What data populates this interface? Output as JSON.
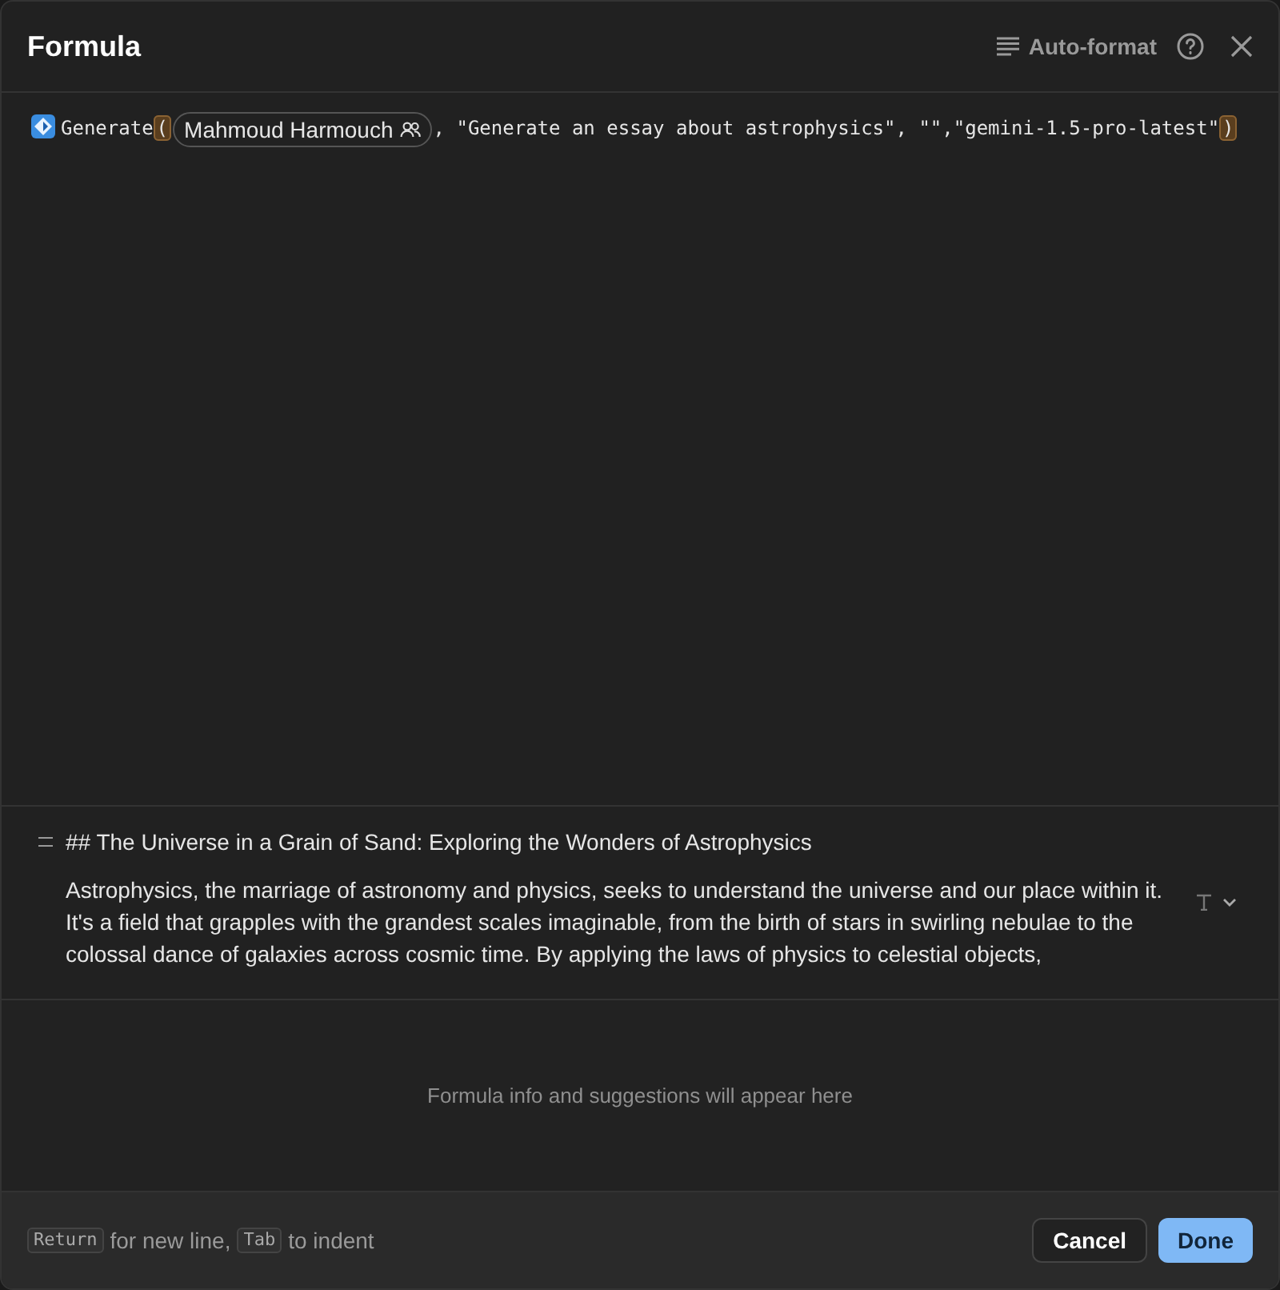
{
  "dialog": {
    "title": "Formula",
    "auto_format": "Auto-format"
  },
  "formula": [
    {
      "kind": "function",
      "text": "Generate"
    },
    {
      "kind": "paren",
      "text": "("
    },
    {
      "kind": "chip",
      "text": "Mahmoud Harmouch"
    },
    {
      "kind": "text",
      "text": ", \"Generate an essay about astrophysics\", \"\",\"gemini-1.5-pro-latest\""
    },
    {
      "kind": "paren",
      "text": ")"
    }
  ],
  "result": {
    "heading": "## The Universe in a Grain of Sand: Exploring the Wonders of Astrophysics",
    "body": "Astrophysics, the marriage of astronomy and physics, seeks to understand the universe and our place within it.  It's a field that grapples with the grandest scales imaginable, from the birth of stars in swirling nebulae to the colossal dance of galaxies across cosmic time.  By applying the laws of physics to celestial objects,"
  },
  "info": "Formula info and suggestions will appear here",
  "footer": {
    "hint": [
      {
        "kind": "key",
        "text": "Return"
      },
      {
        "kind": "text",
        "text": "for new line,"
      },
      {
        "kind": "key",
        "text": "Tab"
      },
      {
        "kind": "text",
        "text": "to indent"
      }
    ],
    "buttons": [
      {
        "label": "Cancel",
        "primary": false
      },
      {
        "label": "Done",
        "primary": true
      }
    ]
  }
}
